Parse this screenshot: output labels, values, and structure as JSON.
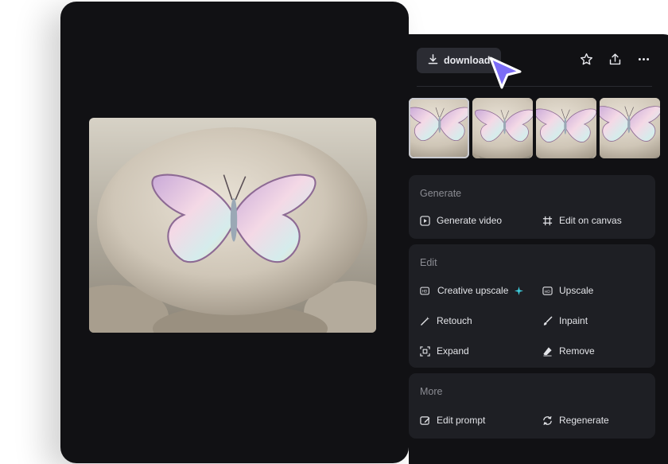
{
  "toolbar": {
    "download_label": "download",
    "icons": [
      "star-icon",
      "share-icon",
      "more-icon"
    ]
  },
  "thumbnails": [
    {
      "selected": true
    },
    {
      "selected": false
    },
    {
      "selected": false
    },
    {
      "selected": false
    }
  ],
  "sections": {
    "generate": {
      "title": "Generate",
      "items": [
        "Generate video",
        "Edit on canvas"
      ]
    },
    "edit": {
      "title": "Edit",
      "items": [
        "Creative upscale",
        "Upscale",
        "Retouch",
        "Inpaint",
        "Expand",
        "Remove"
      ]
    },
    "more": {
      "title": "More",
      "items": [
        "Edit prompt",
        "Regenerate"
      ]
    }
  },
  "colors": {
    "background": "#111114",
    "card": "#1e1f24",
    "accent_cursor": "#7b6cf6",
    "sparkle": "#3fd0e0"
  }
}
